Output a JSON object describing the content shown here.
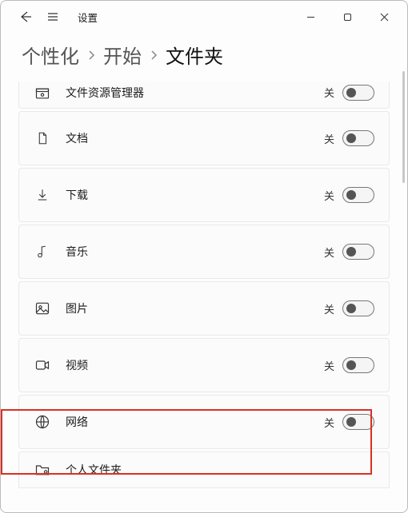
{
  "titlebar": {
    "title": "设置"
  },
  "breadcrumb": {
    "items": [
      {
        "label": "个性化"
      },
      {
        "label": "开始"
      },
      {
        "label": "文件夹"
      }
    ]
  },
  "state_off": "关",
  "rows": [
    {
      "icon": "file-explorer-icon",
      "label": "文件资源管理器",
      "state_key": "state_off",
      "on": false
    },
    {
      "icon": "document-icon",
      "label": "文档",
      "state_key": "state_off",
      "on": false
    },
    {
      "icon": "download-icon",
      "label": "下载",
      "state_key": "state_off",
      "on": false
    },
    {
      "icon": "music-icon",
      "label": "音乐",
      "state_key": "state_off",
      "on": false
    },
    {
      "icon": "pictures-icon",
      "label": "图片",
      "state_key": "state_off",
      "on": false
    },
    {
      "icon": "videos-icon",
      "label": "视频",
      "state_key": "state_off",
      "on": false
    },
    {
      "icon": "network-icon",
      "label": "网络",
      "state_key": "state_off",
      "on": false,
      "highlight": true
    },
    {
      "icon": "personal-folder-icon",
      "label": "个人文件夹",
      "state_key": "state_off",
      "on": false
    }
  ]
}
